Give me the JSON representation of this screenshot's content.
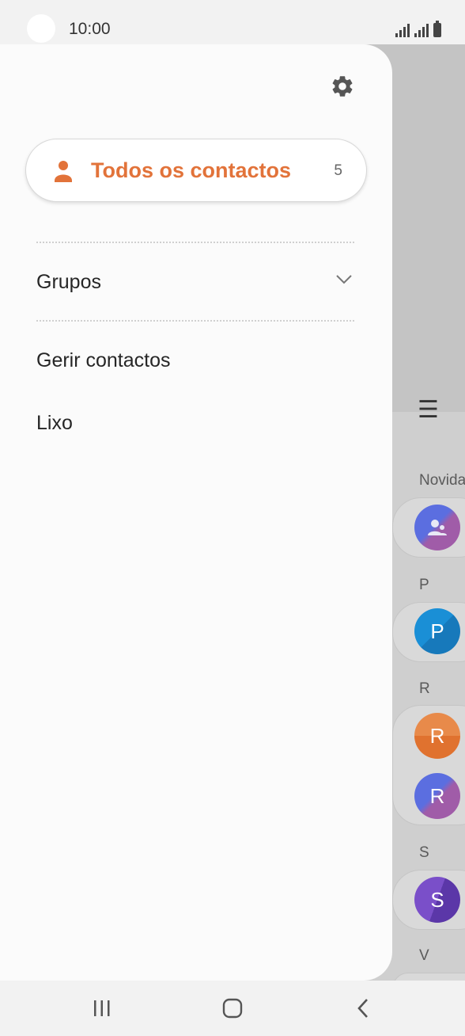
{
  "status_bar": {
    "time": "10:00"
  },
  "drawer": {
    "all_contacts": {
      "label": "Todos os contactos",
      "count": "5",
      "accent": "#e2733a"
    },
    "groups_label": "Grupos",
    "manage_label": "Gerir contactos",
    "trash_label": "Lixo"
  },
  "background": {
    "headers": [
      "Novida",
      "P",
      "R",
      "S",
      "V"
    ],
    "avatars": [
      "",
      "P",
      "R",
      "R",
      "S"
    ]
  },
  "icons": {
    "settings": "gear-icon",
    "person": "person-icon",
    "chevron": "chevron-down-icon",
    "menu": "hamburger-menu-icon"
  }
}
